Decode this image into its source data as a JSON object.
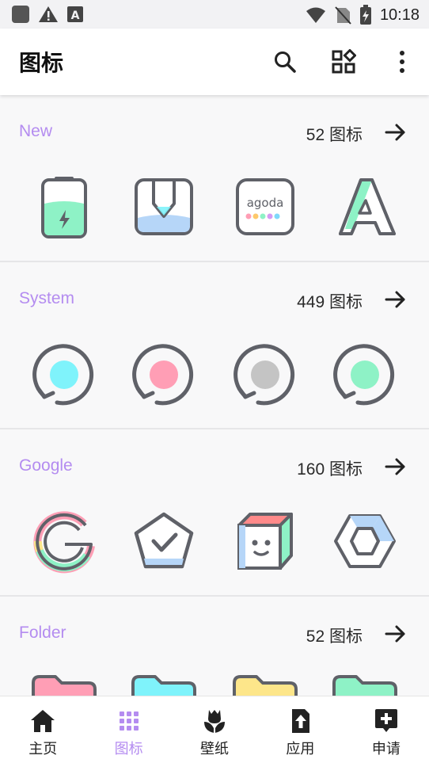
{
  "status_bar": {
    "time": "10:18",
    "left_icons": [
      "app-square-icon",
      "warning-icon",
      "text-a-icon"
    ],
    "right_icons": [
      "wifi-icon",
      "no-sim-icon",
      "battery-charging-icon"
    ]
  },
  "app_bar": {
    "title": "图标",
    "actions": [
      "search-icon",
      "grid-shapes-icon",
      "more-vert-icon"
    ]
  },
  "sections": [
    {
      "title": "New",
      "count": "52 图标",
      "icons": [
        "battery-app-icon",
        "pencil-app-icon",
        "agoda-app-icon",
        "letter-a-app-icon"
      ],
      "agoda_text": "agoda"
    },
    {
      "title": "System",
      "count": "449 图标",
      "icons": [
        "rotate-cyan-icon",
        "rotate-pink-icon",
        "rotate-gray-icon",
        "rotate-mint-icon"
      ]
    },
    {
      "title": "Google",
      "count": "160 图标",
      "icons": [
        "google-g-icon",
        "pentagon-check-icon",
        "cube-face-icon",
        "hexagon-icon"
      ]
    },
    {
      "title": "Folder",
      "count": "52 图标",
      "icons": [
        "folder-pink-icon",
        "folder-cyan-icon",
        "folder-yellow-icon",
        "folder-mint-icon"
      ]
    }
  ],
  "bottom_nav": {
    "active": "图标",
    "items": [
      {
        "label": "主页",
        "icon": "home-icon"
      },
      {
        "label": "图标",
        "icon": "dots-grid-icon"
      },
      {
        "label": "壁纸",
        "icon": "tulip-icon"
      },
      {
        "label": "应用",
        "icon": "upload-icon"
      },
      {
        "label": "申请",
        "icon": "request-plus-icon"
      }
    ]
  },
  "colors": {
    "accent": "#b48cf0",
    "outline": "#5f6168",
    "cyan": "#7ff3fb",
    "pink": "#ff9eb5",
    "mint": "#8ef2c6",
    "gray": "#c4c4c4",
    "yellow": "#fde68a",
    "blue": "#b6d6f8"
  }
}
